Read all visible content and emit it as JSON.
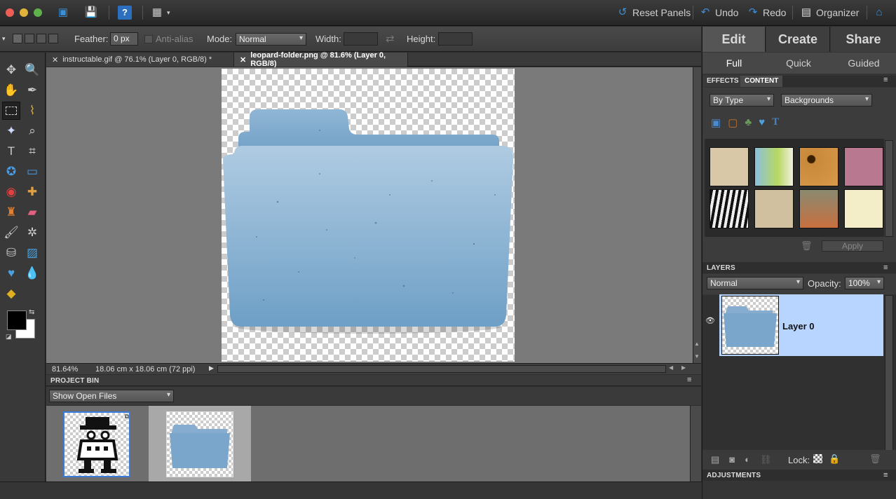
{
  "titlebar": {
    "reset_panels": "Reset Panels",
    "undo": "Undo",
    "redo": "Redo",
    "organizer": "Organizer"
  },
  "options": {
    "feather_label": "Feather:",
    "feather_value": "0 px",
    "antialias_label": "Anti-alias",
    "mode_label": "Mode:",
    "mode_value": "Normal",
    "width_label": "Width:",
    "height_label": "Height:"
  },
  "doc_tabs": [
    {
      "label": "instructable.gif @ 76.1% (Layer 0, RGB/8) *"
    },
    {
      "label": "leopard-folder.png @ 81.6% (Layer 0, RGB/8)"
    }
  ],
  "status": {
    "zoom": "81.64%",
    "size": "18.06 cm x 18.06 cm (72 ppi)"
  },
  "project_bin": {
    "title": "PROJECT BIN",
    "filter": "Show Open Files"
  },
  "right": {
    "tabs": [
      "Edit",
      "Create",
      "Share"
    ],
    "subtabs": [
      "Full",
      "Quick",
      "Guided"
    ],
    "panel_tabs": [
      "EFFECTS",
      "CONTENT"
    ],
    "content_by": "By Type",
    "content_category": "Backgrounds",
    "apply": "Apply"
  },
  "layers": {
    "title": "LAYERS",
    "blend": "Normal",
    "opacity_label": "Opacity:",
    "opacity": "100%",
    "layer_name": "Layer 0",
    "lock_label": "Lock:"
  },
  "adjustments": {
    "title": "ADJUSTMENTS"
  },
  "colors": {
    "accent": "#3a8fd8",
    "selected_layer": "#b8d5ff"
  }
}
